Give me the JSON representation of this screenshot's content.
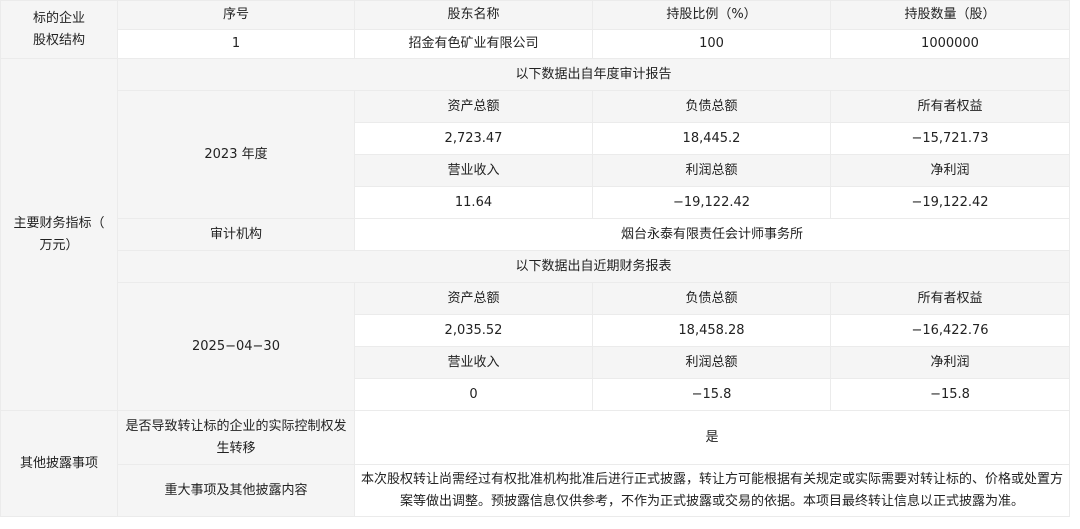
{
  "equity": {
    "section_label": "标的企业\n股权结构",
    "headers": [
      "序号",
      "股东名称",
      "持股比例（%）",
      "持股数量（股）"
    ],
    "row": [
      "1",
      "招金有色矿业有限公司",
      "100",
      "1000000"
    ]
  },
  "financials": {
    "section_label": "主要财务指标（\n万元）",
    "annual_caption": "以下数据出自年度审计报告",
    "annual_period": "2023 年度",
    "annual_h1": [
      "资产总额",
      "负债总额",
      "所有者权益"
    ],
    "annual_v1": [
      "2,723.47",
      "18,445.2",
      "−15,721.73"
    ],
    "annual_h2": [
      "营业收入",
      "利润总额",
      "净利润"
    ],
    "annual_v2": [
      "11.64",
      "−19,122.42",
      "−19,122.42"
    ],
    "auditor_label": "审计机构",
    "auditor_value": "烟台永泰有限责任会计师事务所",
    "recent_caption": "以下数据出自近期财务报表",
    "recent_period": "2025−04−30",
    "recent_h1": [
      "资产总额",
      "负债总额",
      "所有者权益"
    ],
    "recent_v1": [
      "2,035.52",
      "18,458.28",
      "−16,422.76"
    ],
    "recent_h2": [
      "营业收入",
      "利润总额",
      "净利润"
    ],
    "recent_v2": [
      "0",
      "−15.8",
      "−15.8"
    ]
  },
  "other": {
    "section_label": "其他披露事项",
    "control_change_label": "是否导致转让标的企业的实际控制权发生转移",
    "control_change_value": "是",
    "major_matters_label": "重大事项及其他披露内容",
    "major_matters_value": "本次股权转让尚需经过有权批准机构批准后进行正式披露，转让方可能根据有关规定或实际需要对转让标的、价格或处置方案等做出调整。预披露信息仅供参考，不作为正式披露或交易的依据。本项目最终转让信息以正式披露为准。"
  }
}
